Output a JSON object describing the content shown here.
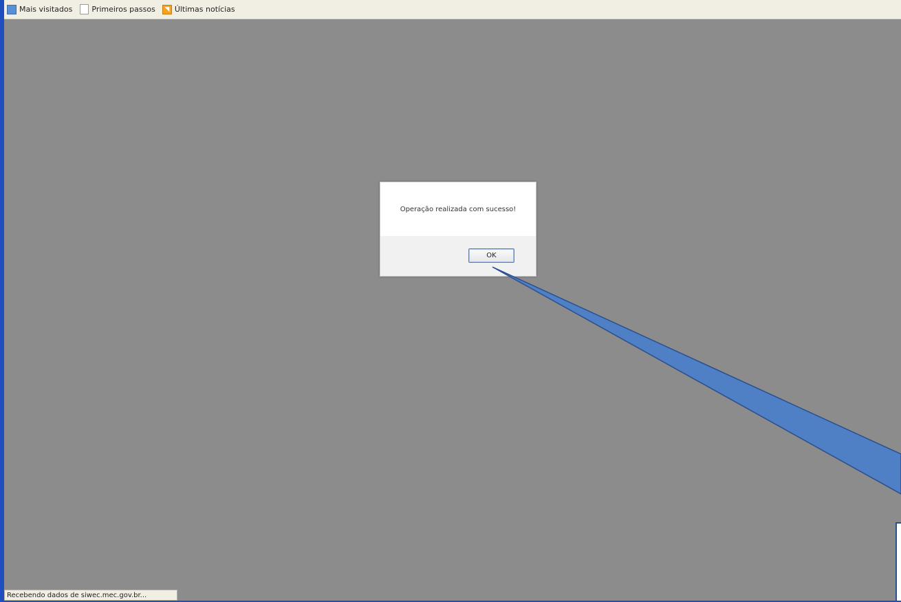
{
  "bookmarks": [
    {
      "label": "Mais visitados",
      "icon": "most-visited-icon"
    },
    {
      "label": "Primeiros passos",
      "icon": "page-icon"
    },
    {
      "label": "Últimas notícias",
      "icon": "rss-icon"
    }
  ],
  "dialog": {
    "message": "Operação realizada com sucesso!",
    "ok_label": "OK"
  },
  "status_bar": {
    "text": "Recebendo dados de siwec.mec.gov.br..."
  },
  "colors": {
    "frame_blue": "#1f4fbf",
    "overlay_gray": "#8c8c8c",
    "callout_fill": "#4f7fc4",
    "callout_stroke": "#2a4f8c"
  }
}
